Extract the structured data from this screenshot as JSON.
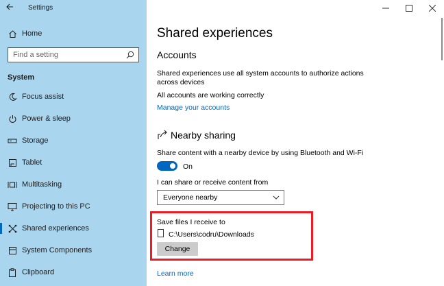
{
  "window": {
    "title": "Settings",
    "controls": [
      "minimize",
      "maximize",
      "close"
    ]
  },
  "sidebar": {
    "home_label": "Home",
    "search_placeholder": "Find a setting",
    "section": "System",
    "items": [
      {
        "label": "Focus assist",
        "icon": "moon-icon"
      },
      {
        "label": "Power & sleep",
        "icon": "power-icon"
      },
      {
        "label": "Storage",
        "icon": "storage-icon"
      },
      {
        "label": "Tablet",
        "icon": "tablet-icon"
      },
      {
        "label": "Multitasking",
        "icon": "multitasking-icon"
      },
      {
        "label": "Projecting to this PC",
        "icon": "projecting-icon"
      },
      {
        "label": "Shared experiences",
        "icon": "shared-experiences-icon",
        "active": true
      },
      {
        "label": "System Components",
        "icon": "components-icon"
      },
      {
        "label": "Clipboard",
        "icon": "clipboard-icon"
      }
    ]
  },
  "main": {
    "page_title": "Shared experiences",
    "accounts": {
      "heading": "Accounts",
      "description": "Shared experiences use all system accounts to authorize actions across devices",
      "status": "All accounts are working correctly",
      "manage_link": "Manage your accounts"
    },
    "nearby": {
      "heading": "Nearby sharing",
      "description": "Share content with a nearby device by using Bluetooth and Wi-Fi",
      "toggle_state": "On",
      "share_label": "I can share or receive content from",
      "share_value": "Everyone nearby",
      "save_label": "Save files I receive to",
      "save_path": "C:\\Users\\codru\\Downloads",
      "change_button": "Change"
    },
    "learn_more": "Learn more"
  },
  "colors": {
    "sidebar_bg": "#a9d5ee",
    "accent": "#0067c0",
    "highlight_border": "#ec1c24"
  }
}
